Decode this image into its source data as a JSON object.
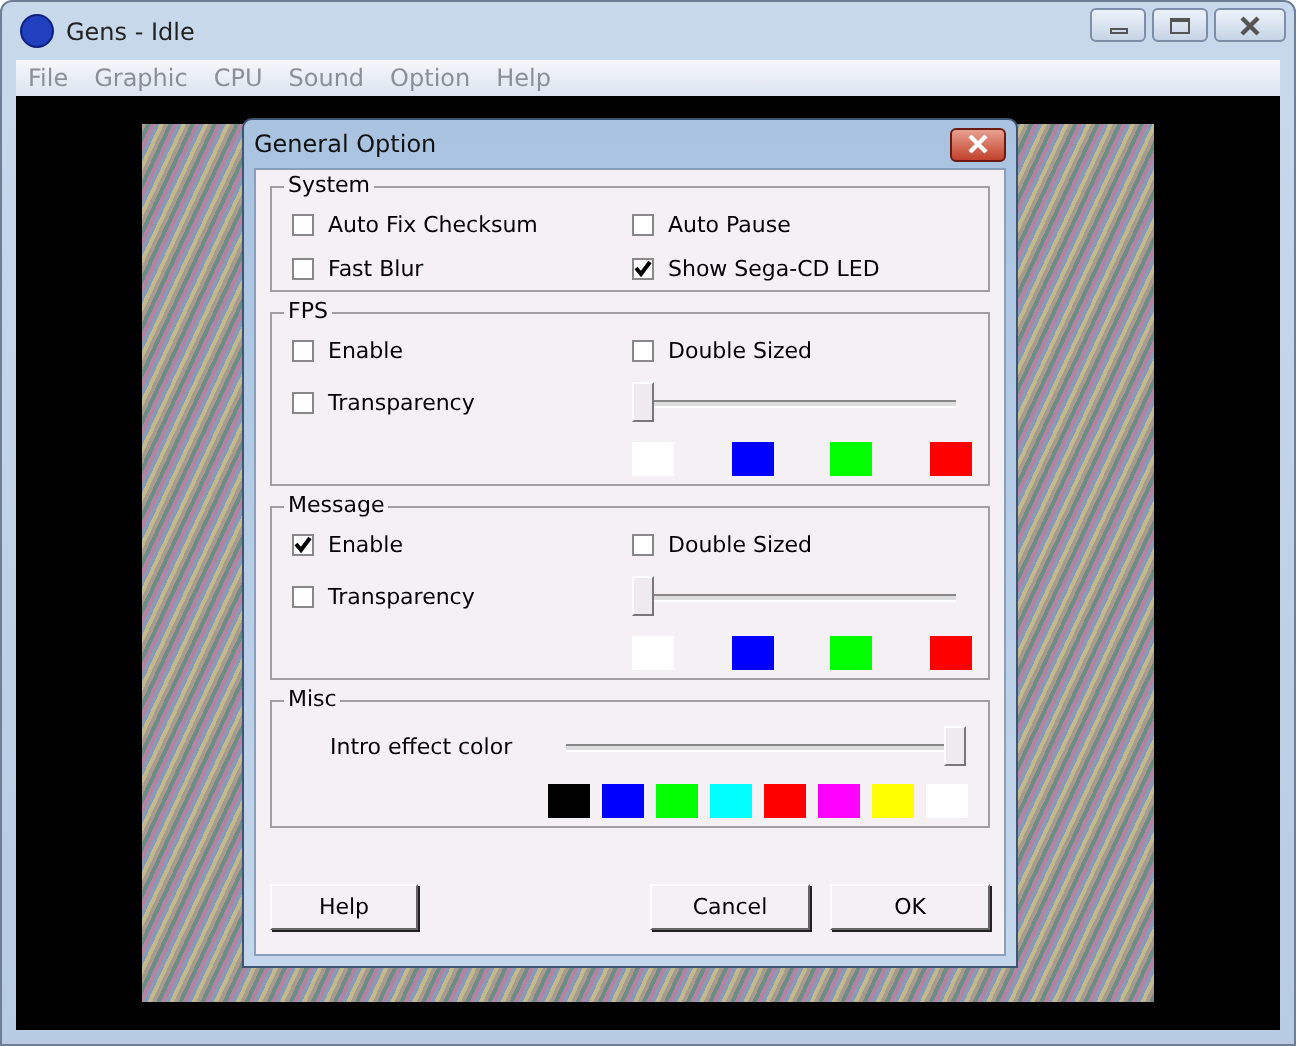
{
  "window": {
    "title": "Gens - Idle"
  },
  "menu": [
    "File",
    "Graphic",
    "CPU",
    "Sound",
    "Option",
    "Help"
  ],
  "dialog": {
    "title": "General Option",
    "sections": [
      {
        "title": "System",
        "items": [
          {
            "kind": "checkbox",
            "label": "Auto Fix Checksum",
            "checked": false
          },
          {
            "kind": "checkbox",
            "label": "Auto Pause",
            "checked": false
          },
          {
            "kind": "checkbox",
            "label": "Fast Blur",
            "checked": false
          },
          {
            "kind": "checkbox",
            "label": "Show Sega-CD LED",
            "checked": true
          }
        ]
      },
      {
        "title": "FPS",
        "items": [
          {
            "kind": "checkbox",
            "label": "Enable",
            "checked": false
          },
          {
            "kind": "checkbox",
            "label": "Double Sized",
            "checked": false
          },
          {
            "kind": "checkbox",
            "label": "Transparency",
            "checked": false
          },
          {
            "kind": "slider",
            "level": 0
          },
          {
            "kind": "swatches",
            "swatches": [
              {
                "color": "#ffffff"
              },
              {
                "color": "#0000ff"
              },
              {
                "color": "#00ff00"
              },
              {
                "color": "#ff0000"
              }
            ]
          }
        ]
      },
      {
        "title": "Message",
        "items": [
          {
            "kind": "checkbox",
            "label": "Enable",
            "checked": true
          },
          {
            "kind": "checkbox",
            "label": "Double Sized",
            "checked": false
          },
          {
            "kind": "checkbox",
            "label": "Transparency",
            "checked": false
          },
          {
            "kind": "slider",
            "level": 0
          },
          {
            "kind": "swatches",
            "swatches": [
              {
                "color": "#ffffff"
              },
              {
                "color": "#0000ff"
              },
              {
                "color": "#00ff00"
              },
              {
                "color": "#ff0000"
              }
            ]
          }
        ]
      },
      {
        "title": "Misc",
        "items": [
          {
            "kind": "label",
            "label": "Intro effect color"
          },
          {
            "kind": "slider",
            "level": 1
          },
          {
            "kind": "swatches",
            "swatches": [
              {
                "color": "#000000"
              },
              {
                "color": "#0000ff"
              },
              {
                "color": "#00ff00"
              },
              {
                "color": "#00ffff"
              },
              {
                "color": "#ff0000"
              },
              {
                "color": "#ff00ff"
              },
              {
                "color": "#ffff00"
              },
              {
                "color": "#ffffff"
              }
            ]
          }
        ]
      }
    ],
    "buttons": [
      "Help",
      "Cancel",
      "OK"
    ]
  }
}
